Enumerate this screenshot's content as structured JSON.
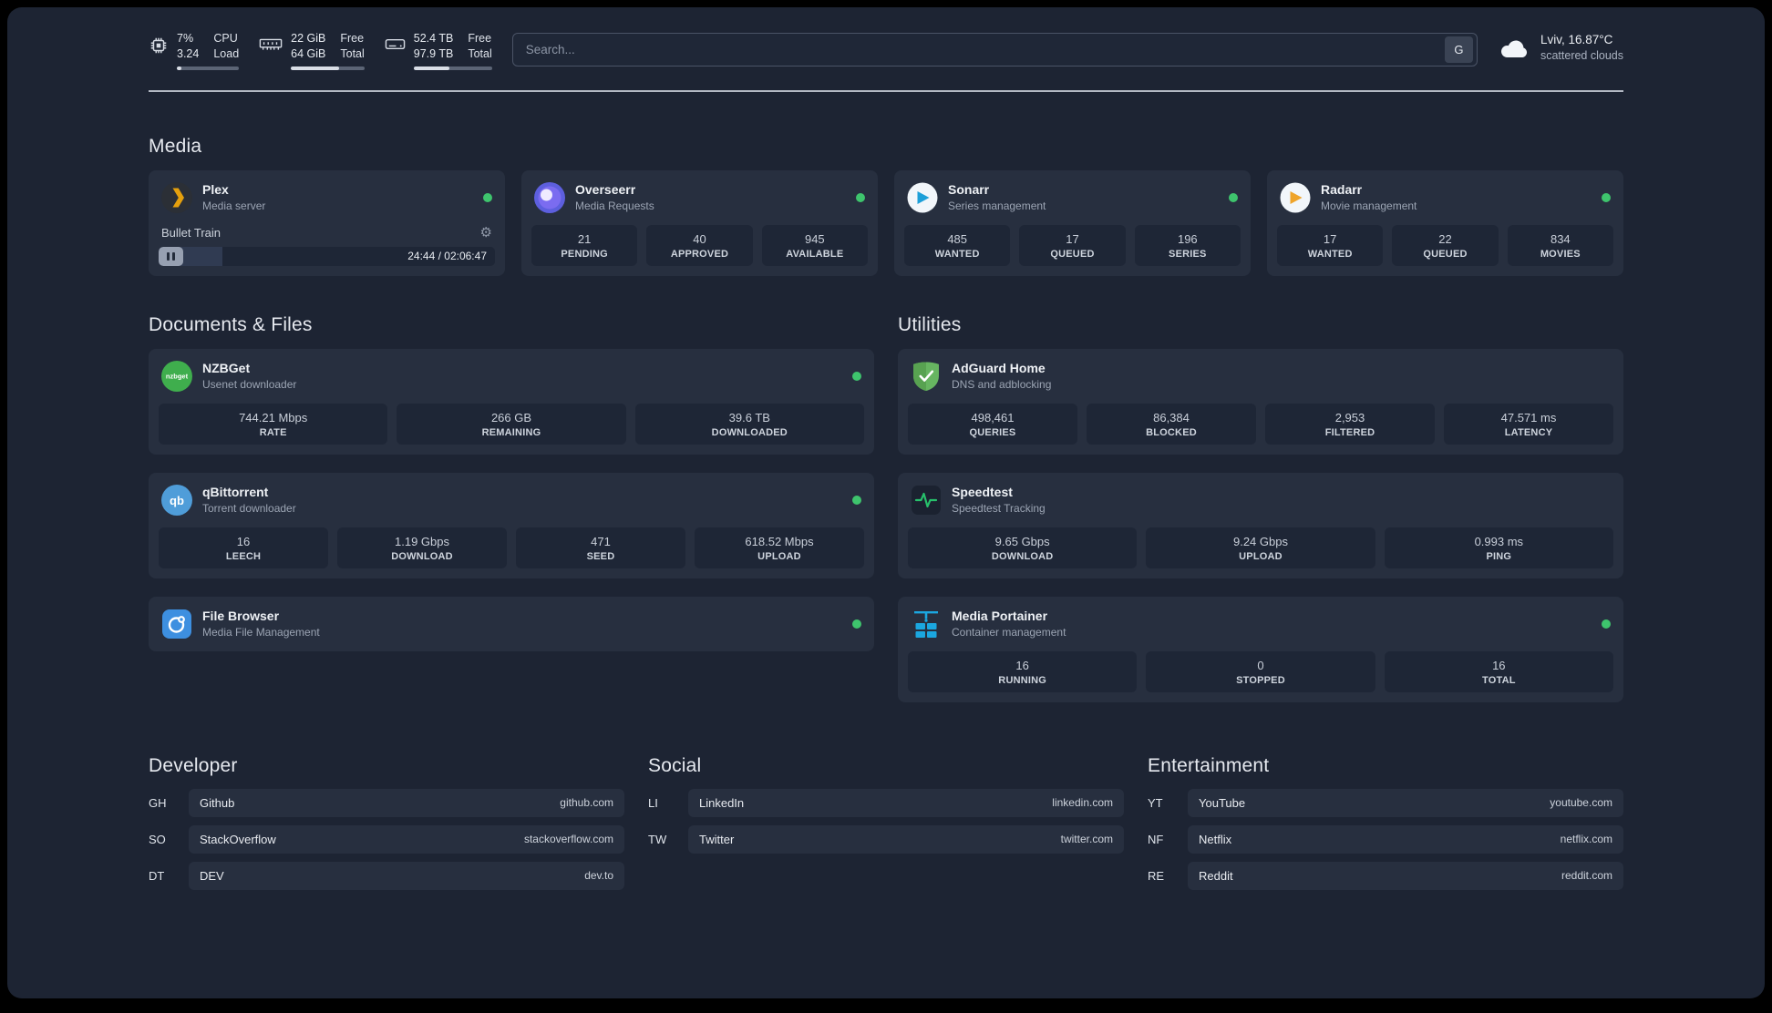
{
  "colors": {
    "background": "#1d2433",
    "card": "#272f3f",
    "stat_box": "#1e2636",
    "status_online": "#3ec46d",
    "plex_accent": "#e5a00d",
    "speedtest_line": "#27c16b"
  },
  "topbar": {
    "cpu": {
      "value": "7%",
      "load": "3.24",
      "label_top": "CPU",
      "label_bottom": "Load",
      "bar_percent": 7
    },
    "memory": {
      "free": "22 GiB",
      "total": "64 GiB",
      "label_top": "Free",
      "label_bottom": "Total",
      "bar_percent": 66
    },
    "disk": {
      "free": "52.4 TB",
      "total": "97.9 TB",
      "label_top": "Free",
      "label_bottom": "Total",
      "bar_percent": 46
    },
    "search": {
      "placeholder": "Search...",
      "provider_button": "G"
    },
    "weather": {
      "location": "Lviv, 16.87°C",
      "condition": "scattered clouds"
    }
  },
  "sections": {
    "media": "Media",
    "documents": "Documents & Files",
    "utilities": "Utilities"
  },
  "services": {
    "plex": {
      "name": "Plex",
      "desc": "Media server",
      "now_playing": "Bullet Train",
      "time": "24:44 / 02:06:47",
      "progress_percent": 19
    },
    "overseerr": {
      "name": "Overseerr",
      "desc": "Media Requests",
      "stats": [
        {
          "value": "21",
          "label": "PENDING"
        },
        {
          "value": "40",
          "label": "APPROVED"
        },
        {
          "value": "945",
          "label": "AVAILABLE"
        }
      ]
    },
    "sonarr": {
      "name": "Sonarr",
      "desc": "Series management",
      "stats": [
        {
          "value": "485",
          "label": "WANTED"
        },
        {
          "value": "17",
          "label": "QUEUED"
        },
        {
          "value": "196",
          "label": "SERIES"
        }
      ]
    },
    "radarr": {
      "name": "Radarr",
      "desc": "Movie management",
      "stats": [
        {
          "value": "17",
          "label": "WANTED"
        },
        {
          "value": "22",
          "label": "QUEUED"
        },
        {
          "value": "834",
          "label": "MOVIES"
        }
      ]
    },
    "nzbget": {
      "name": "NZBGet",
      "desc": "Usenet downloader",
      "stats": [
        {
          "value": "744.21 Mbps",
          "label": "RATE"
        },
        {
          "value": "266 GB",
          "label": "REMAINING"
        },
        {
          "value": "39.6 TB",
          "label": "DOWNLOADED"
        }
      ]
    },
    "qbittorrent": {
      "name": "qBittorrent",
      "desc": "Torrent downloader",
      "stats": [
        {
          "value": "16",
          "label": "LEECH"
        },
        {
          "value": "1.19 Gbps",
          "label": "DOWNLOAD"
        },
        {
          "value": "471",
          "label": "SEED"
        },
        {
          "value": "618.52 Mbps",
          "label": "UPLOAD"
        }
      ]
    },
    "filebrowser": {
      "name": "File Browser",
      "desc": "Media File Management"
    },
    "adguard": {
      "name": "AdGuard Home",
      "desc": "DNS and adblocking",
      "stats": [
        {
          "value": "498,461",
          "label": "QUERIES"
        },
        {
          "value": "86,384",
          "label": "BLOCKED"
        },
        {
          "value": "2,953",
          "label": "FILTERED"
        },
        {
          "value": "47.571 ms",
          "label": "LATENCY"
        }
      ]
    },
    "speedtest": {
      "name": "Speedtest",
      "desc": "Speedtest Tracking",
      "stats": [
        {
          "value": "9.65 Gbps",
          "label": "DOWNLOAD"
        },
        {
          "value": "9.24 Gbps",
          "label": "UPLOAD"
        },
        {
          "value": "0.993 ms",
          "label": "PING"
        }
      ]
    },
    "portainer": {
      "name": "Media Portainer",
      "desc": "Container management",
      "stats": [
        {
          "value": "16",
          "label": "RUNNING"
        },
        {
          "value": "0",
          "label": "STOPPED"
        },
        {
          "value": "16",
          "label": "TOTAL"
        }
      ]
    }
  },
  "bookmarks": {
    "developer": {
      "title": "Developer",
      "items": [
        {
          "abbr": "GH",
          "name": "Github",
          "url": "github.com"
        },
        {
          "abbr": "SO",
          "name": "StackOverflow",
          "url": "stackoverflow.com"
        },
        {
          "abbr": "DT",
          "name": "DEV",
          "url": "dev.to"
        }
      ]
    },
    "social": {
      "title": "Social",
      "items": [
        {
          "abbr": "LI",
          "name": "LinkedIn",
          "url": "linkedin.com"
        },
        {
          "abbr": "TW",
          "name": "Twitter",
          "url": "twitter.com"
        }
      ]
    },
    "entertainment": {
      "title": "Entertainment",
      "items": [
        {
          "abbr": "YT",
          "name": "YouTube",
          "url": "youtube.com"
        },
        {
          "abbr": "NF",
          "name": "Netflix",
          "url": "netflix.com"
        },
        {
          "abbr": "RE",
          "name": "Reddit",
          "url": "reddit.com"
        }
      ]
    }
  }
}
